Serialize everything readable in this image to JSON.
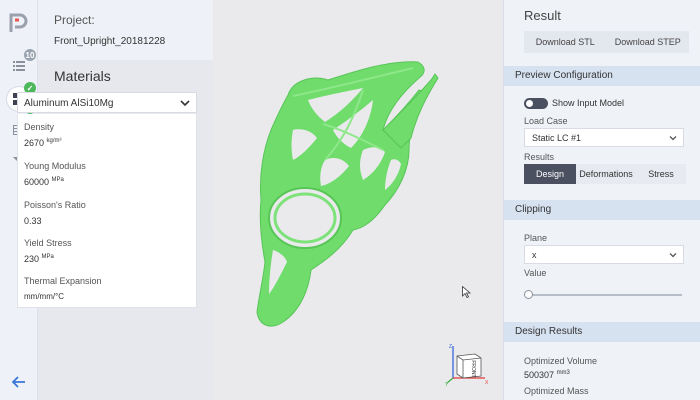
{
  "rail": {
    "items": [
      {
        "icon": "list-icon",
        "badge": "10"
      },
      {
        "icon": "grid-icon",
        "badge": "✓"
      },
      {
        "icon": "table-icon",
        "badge": "✓"
      },
      {
        "icon": "filter-icon",
        "badge": "✓"
      }
    ]
  },
  "project": {
    "label": "Project:",
    "name": "Front_Upright_20181228"
  },
  "materials": {
    "title": "Materials",
    "selected": "Aluminum AlSi10Mg",
    "properties": [
      {
        "name": "Density",
        "value": "2670",
        "unit": "kg/m³"
      },
      {
        "name": "Young Modulus",
        "value": "60000",
        "unit": "MPa"
      },
      {
        "name": "Poisson's Ratio",
        "value": "0.33",
        "unit": ""
      },
      {
        "name": "Yield Stress",
        "value": "230",
        "unit": "MPa"
      },
      {
        "name": "Thermal Expansion",
        "value": "mm/mm/°C",
        "unit": ""
      }
    ]
  },
  "result": {
    "title": "Result",
    "download_stl": "Download STL",
    "download_step": "Download STEP"
  },
  "preview": {
    "title": "Preview Configuration",
    "toggle_label": "Show Input Model",
    "toggle_on": false,
    "load_case_label": "Load Case",
    "load_case_value": "Static LC #1",
    "results_label": "Results",
    "result_tabs": [
      "Design",
      "Deformations",
      "Stress"
    ],
    "active_tab": "Design"
  },
  "clipping": {
    "title": "Clipping",
    "plane_label": "Plane",
    "plane_value": "x",
    "value_label": "Value",
    "slider_value": 0
  },
  "design_results": {
    "title": "Design Results",
    "optimized_volume_label": "Optimized Volume",
    "optimized_volume_value": "500307",
    "optimized_volume_unit": "mm3",
    "optimized_mass_label": "Optimized Mass"
  },
  "cube": {
    "face_label": "FRONT",
    "x": "X",
    "y": "Y",
    "z": "Z"
  },
  "colors": {
    "part": "#6fdc6c",
    "accent": "#4a5060",
    "badge": "#4cb85a"
  }
}
